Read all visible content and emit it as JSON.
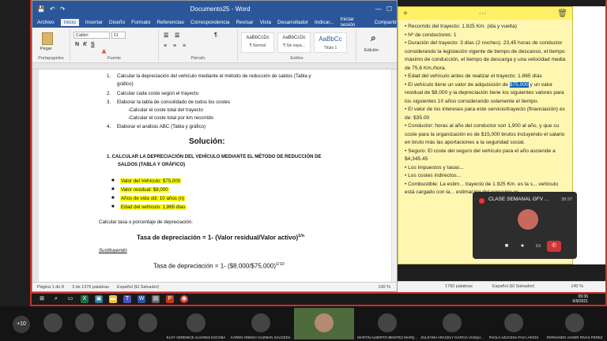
{
  "word": {
    "title": "Documento25 - Word",
    "tabs": [
      "Archivo",
      "Inicio",
      "Insertar",
      "Diseño",
      "Formato",
      "Referencias",
      "Correspondencia",
      "Revisar",
      "Vista",
      "Desarrollador",
      "Indicar...",
      "Iniciar sesión",
      "Compartir"
    ],
    "ribbon": {
      "paste": "Pegar",
      "clipboard": "Portapapeles",
      "font_name": "Calibri",
      "font_size": "11",
      "font_group": "Fuente",
      "paragraph_group": "Párrafo",
      "styles_group": "Estilos",
      "edit": "Edición",
      "styles": [
        {
          "sample": "AaBbCcDc",
          "name": "¶ Normal"
        },
        {
          "sample": "AaBbCcDc",
          "name": "¶ Sin espa..."
        },
        {
          "sample": "AaBbCc",
          "name": "Título 1"
        }
      ]
    },
    "doc": {
      "items": [
        {
          "n": "1.",
          "t": "Calcular la depreciación del vehículo mediante el método de reducción de saldos (Tabla y"
        },
        {
          "n": "",
          "t": "gráfico)"
        },
        {
          "n": "2.",
          "t": "Calcular cada coste según el trayecto"
        },
        {
          "n": "3.",
          "t": "Elaborar la tabla de consolidado de todos los costes"
        },
        {
          "n": "",
          "t": "-Calcular el coste total del trayecto"
        },
        {
          "n": "",
          "t": "-Calcular el coste total por km recorrido"
        },
        {
          "n": "4.",
          "t": "Elaborar el análisis ABC (Tabla y gráfico)"
        }
      ],
      "solution_heading": "Solución:",
      "section_title_1": "1.   CALCULAR LA DEPRECIACIÓN DEL VEHÍCULO MEDIANTE EL MÉTODO DE REDUCCIÓN DE",
      "section_title_2": "SALDOS (TABLA Y GRÁFICO)",
      "highlights": [
        "Valor del Vehículo: $75,000",
        "Valor residual: $8,000",
        "Años de vida útil: 10 años (n)",
        "Edad del vehículo: 1,865 días"
      ],
      "calc_line": "Calcular tasa o porcentaje de depreciación:",
      "formula": "Tasa de depreciación = 1- (Valor residual/Valor activo)",
      "formula_exp": "1/n",
      "substituting": "Sustituyendo",
      "formula2": "Tasa de depreciación = 1- ($8,000/$75,000)",
      "formula2_exp": "1/10"
    },
    "status": {
      "page": "Página 1 de 8",
      "words": "3 de 1276 palabras",
      "lang": "Español (El Salvador)",
      "zoom": "100 %"
    }
  },
  "sticky": {
    "paragraphs": [
      "•        Recorrido del trayecto: 1.925 Km. (ida y vuelta)",
      "•        Nº de conductores: 1",
      "•        Duración del trayecto: 3 días (2 noches). 23,45 horas de conductor considerando la legislación vigente de tiempo de descanso, el tiempo máximo de conducción, el tiempo de descarga y una velocidad media de 75,6 Km./hora.",
      "•        Edad del vehículo antes de realizar el trayecto: 1.865 días"
    ],
    "p5_before": "•        El vehículo tiene un valor de adquisición de ",
    "p5_selected": "$75,000",
    "p5_after": " y un valor residual de $8,000 y la depreciación tiene los siguientes valores para los siguientes 10 años considerando solamente el tiempo.",
    "paragraphs2": [
      "•        El valor de los intereses para este servicio/trayecto (financiación) es de: $35.00",
      "•        Conductor: horas al año del conductor son 1,900 al año, y que su coste para la organización es de $15,000 brutos incluyendo el salario en bruto más las aportaciones a la seguridad social.",
      "•        Seguro: El coste del seguro del vehículo para el año asciende a $4,345.45",
      "•        Los impuestos y tasas...",
      "•        Los costes indirectos...",
      "•        Combustible: La estim... trayecto de 1.925 Km. es la s... vehículo está cargado con la... estimación del consumo es ..."
    ]
  },
  "meeting": {
    "title": "CLASE SEMANAL GFV ...",
    "time": "39:37"
  },
  "word_status_right": {
    "words": "1792 palabras",
    "lang": "Español (El Salvador)",
    "zoom": "140 %"
  },
  "tray": {
    "time": "09:36",
    "date": "6/9/2021"
  },
  "participants": {
    "more": "+10",
    "names": [
      "",
      "",
      "",
      "",
      "ELSY VERENICE ALVAREZ ESCOBA",
      "KAREN ONEIDA GUZMAN SAUCEDA",
      "",
      "MARTIN ALBERTO BENITEZ MARQ...",
      "ZULEYMA ARACELY GARCIA VASQU...",
      "PAOLA AZUCENA PAZ LARIOS",
      "FERNANDO JAVIER RIVAS PEREZ"
    ]
  }
}
